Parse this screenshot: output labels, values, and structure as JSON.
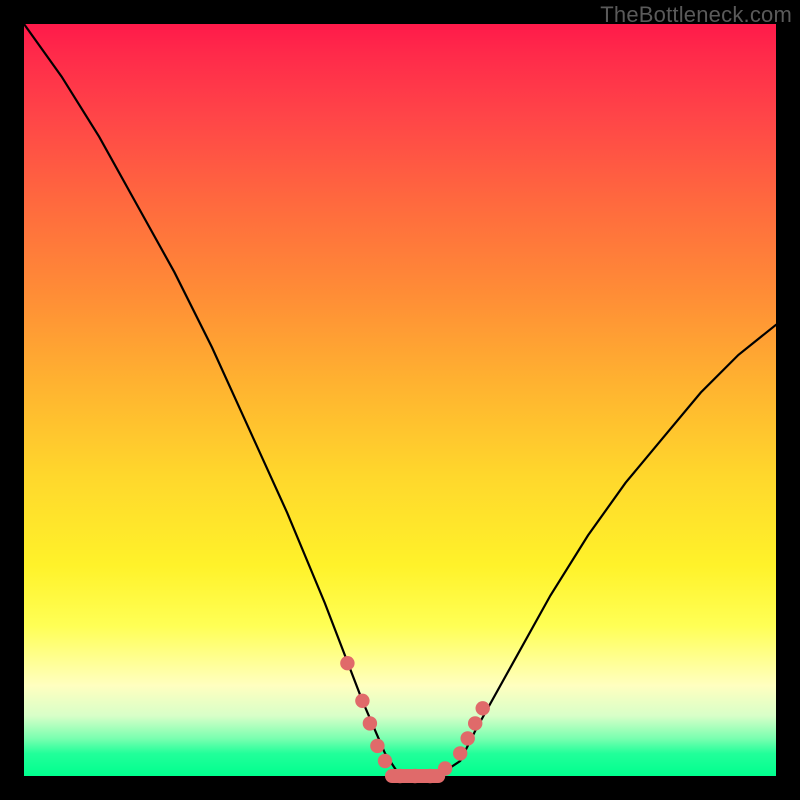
{
  "watermark": "TheBottleneck.com",
  "colors": {
    "frame": "#000000",
    "curve": "#000000",
    "marker": "#e06a6a",
    "gradient_top": "#ff1a4a",
    "gradient_bottom": "#00ff8e"
  },
  "chart_data": {
    "type": "line",
    "title": "",
    "xlabel": "",
    "ylabel": "",
    "xlim": [
      0,
      100
    ],
    "ylim": [
      0,
      100
    ],
    "grid": false,
    "legend": false,
    "annotations": [
      "TheBottleneck.com"
    ],
    "series": [
      {
        "name": "bottleneck-curve",
        "x": [
          0,
          5,
          10,
          15,
          20,
          25,
          30,
          35,
          40,
          45,
          48,
          50,
          52,
          55,
          58,
          60,
          65,
          70,
          75,
          80,
          85,
          90,
          95,
          100
        ],
        "values": [
          100,
          93,
          85,
          76,
          67,
          57,
          46,
          35,
          23,
          10,
          3,
          0,
          0,
          0,
          2,
          6,
          15,
          24,
          32,
          39,
          45,
          51,
          56,
          60
        ]
      }
    ],
    "markers": [
      {
        "x": 43,
        "y": 15,
        "r": 1.2
      },
      {
        "x": 45,
        "y": 10,
        "r": 1.2
      },
      {
        "x": 46,
        "y": 7,
        "r": 1.2
      },
      {
        "x": 47,
        "y": 4,
        "r": 1.2
      },
      {
        "x": 48,
        "y": 2,
        "r": 1.2
      },
      {
        "x": 50,
        "y": 0,
        "r": 1.2
      },
      {
        "x": 52,
        "y": 0,
        "r": 1.2
      },
      {
        "x": 54,
        "y": 0,
        "r": 1.2
      },
      {
        "x": 56,
        "y": 1,
        "r": 1.2
      },
      {
        "x": 58,
        "y": 3,
        "r": 1.2
      },
      {
        "x": 59,
        "y": 5,
        "r": 1.2
      },
      {
        "x": 60,
        "y": 7,
        "r": 1.2
      },
      {
        "x": 61,
        "y": 9,
        "r": 1.2
      }
    ]
  }
}
